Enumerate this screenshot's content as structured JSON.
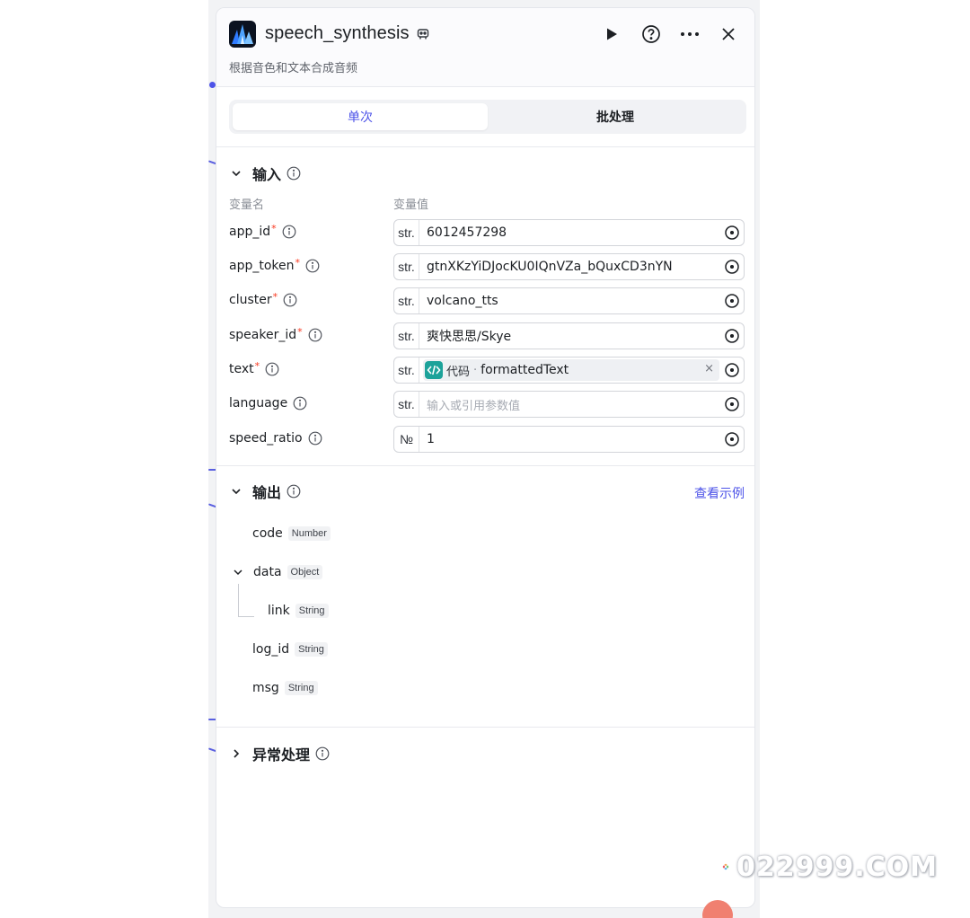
{
  "node": {
    "title": "speech_synthesis",
    "description": "根据音色和文本合成音频"
  },
  "tabs": [
    {
      "label": "单次",
      "active": true
    },
    {
      "label": "批处理",
      "active": false
    }
  ],
  "input": {
    "section_title": "输入",
    "col_name": "变量名",
    "col_value": "变量值",
    "params": [
      {
        "name": "app_id",
        "required": true,
        "type": "str.",
        "value": "6012457298"
      },
      {
        "name": "app_token",
        "required": true,
        "type": "str.",
        "value": "gtnXKzYiDJocKU0IQnVZa_bQuxCD3nYN"
      },
      {
        "name": "cluster",
        "required": true,
        "type": "str.",
        "value": "volcano_tts"
      },
      {
        "name": "speaker_id",
        "required": true,
        "type": "str.",
        "value": "爽快思思/Skye"
      },
      {
        "name": "text",
        "required": true,
        "type": "str.",
        "ref_source": "代码",
        "ref_separator": "·",
        "ref_var": "formattedText",
        "ref_close": "×"
      },
      {
        "name": "language",
        "required": false,
        "type": "str.",
        "placeholder": "输入或引用参数值"
      },
      {
        "name": "speed_ratio",
        "required": false,
        "type": "№",
        "value": "1"
      }
    ],
    "required_mark": "*"
  },
  "output": {
    "section_title": "输出",
    "example_link": "查看示例",
    "fields": [
      {
        "name": "code",
        "type": "Number"
      },
      {
        "name": "data",
        "type": "Object"
      },
      {
        "name": "link",
        "type": "String"
      },
      {
        "name": "log_id",
        "type": "String"
      },
      {
        "name": "msg",
        "type": "String"
      }
    ]
  },
  "exception": {
    "section_title": "异常处理"
  },
  "watermark": {
    "text": "022999.COM"
  },
  "colors": {
    "accent": "#4d53e8",
    "required": "#f93920",
    "code_icon": "#1ca29a"
  }
}
